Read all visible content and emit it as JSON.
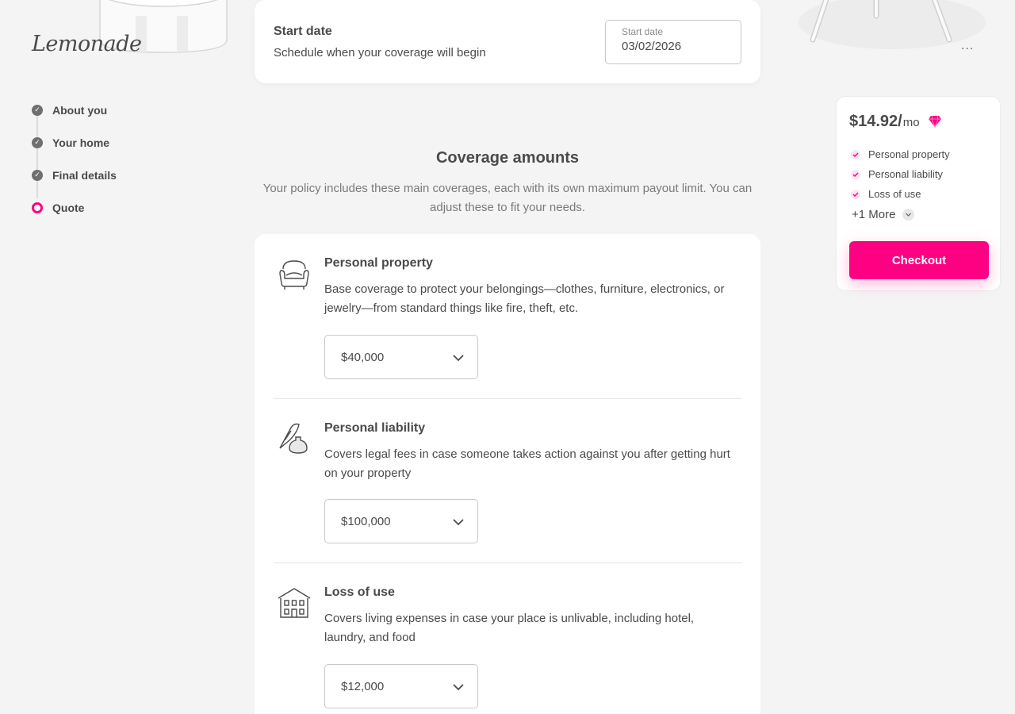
{
  "brand": {
    "logo_text": "Lemonade",
    "accent_color": "#ff0083"
  },
  "steps": [
    {
      "label": "About you",
      "state": "done"
    },
    {
      "label": "Your home",
      "state": "done"
    },
    {
      "label": "Final details",
      "state": "done"
    },
    {
      "label": "Quote",
      "state": "current"
    }
  ],
  "start_date": {
    "title": "Start date",
    "subtitle": "Schedule when your coverage will begin",
    "field_label": "Start date",
    "field_value": "03/02/2026"
  },
  "coverage": {
    "title": "Coverage amounts",
    "description": "Your policy includes these main coverages, each with its own maximum payout limit. You can adjust these to fit your needs.",
    "items": [
      {
        "name": "Personal property",
        "description": "Base coverage to protect your belongings—clothes, furniture, electronics, or jewelry—from standard things like fire, theft, etc.",
        "amount": "$40,000",
        "icon": "armchair-icon"
      },
      {
        "name": "Personal liability",
        "description": "Covers legal fees in case someone takes action against you after getting hurt on your property",
        "amount": "$100,000",
        "icon": "quill-inkwell-icon"
      },
      {
        "name": "Loss of use",
        "description": "Covers living expenses in case your place is unlivable, including hotel, laundry, and food",
        "amount": "$12,000",
        "icon": "building-icon"
      }
    ]
  },
  "summary": {
    "price": "$14.92/",
    "period": "mo",
    "badge_icon": "gem-icon",
    "included": [
      "Personal property",
      "Personal liability",
      "Loss of use"
    ],
    "more_label": "+1 More",
    "checkout_label": "Checkout"
  },
  "menu": {
    "label": "..."
  }
}
